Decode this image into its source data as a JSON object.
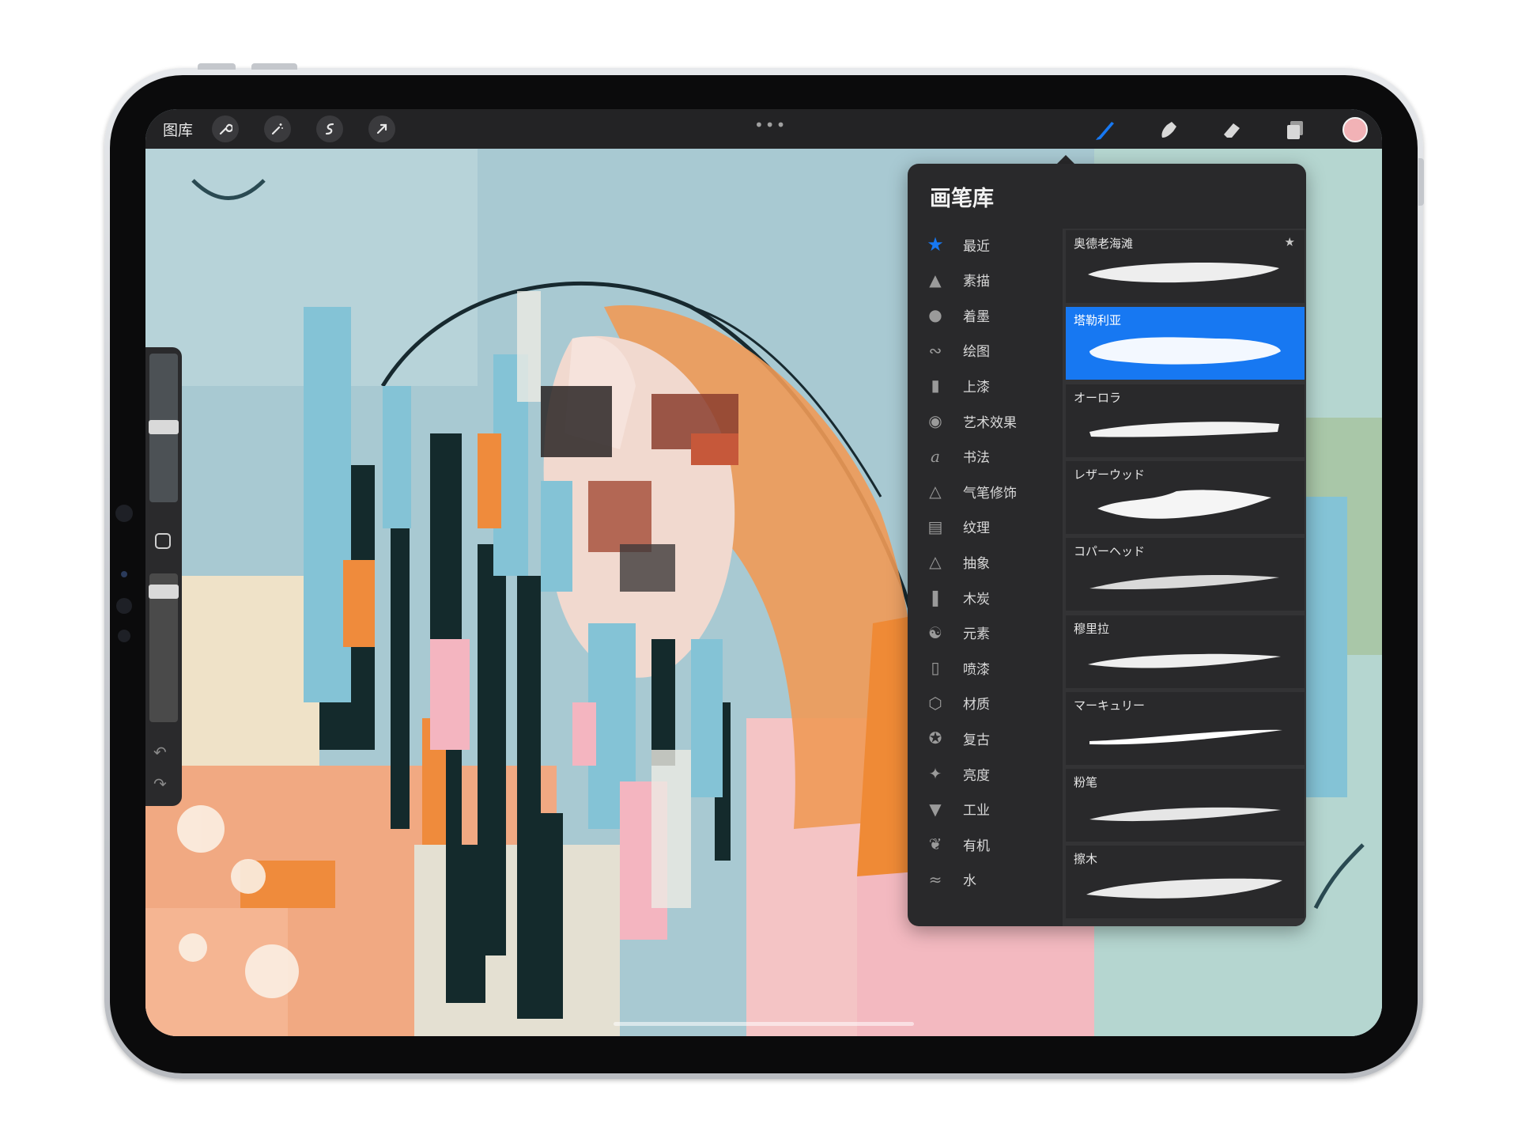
{
  "topbar": {
    "gallery_label": "图库",
    "more_indicator": "•••",
    "current_color": "#f2b2b6",
    "accent_color": "#1778f2",
    "tools_left": [
      "wrench-icon",
      "magic-wand-icon",
      "selection-icon",
      "transform-arrow-icon"
    ],
    "tools_right": [
      "brush-icon",
      "smudge-icon",
      "eraser-icon",
      "layers-icon"
    ]
  },
  "brush_library": {
    "title": "画笔库",
    "categories": [
      {
        "label": "最近",
        "icon": "star-icon",
        "selected": true
      },
      {
        "label": "素描",
        "icon": "pencil-tip-icon"
      },
      {
        "label": "着墨",
        "icon": "ink-drop-icon"
      },
      {
        "label": "绘图",
        "icon": "squiggle-icon"
      },
      {
        "label": "上漆",
        "icon": "paint-roller-icon"
      },
      {
        "label": "艺术效果",
        "icon": "palette-icon"
      },
      {
        "label": "书法",
        "icon": "calligraphy-icon"
      },
      {
        "label": "气笔修饰",
        "icon": "airbrush-icon"
      },
      {
        "label": "纹理",
        "icon": "texture-icon"
      },
      {
        "label": "抽象",
        "icon": "triangle-icon"
      },
      {
        "label": "木炭",
        "icon": "charcoal-icon"
      },
      {
        "label": "元素",
        "icon": "yin-yang-icon"
      },
      {
        "label": "喷漆",
        "icon": "spray-can-icon"
      },
      {
        "label": "材质",
        "icon": "cube-icon"
      },
      {
        "label": "复古",
        "icon": "badge-star-icon"
      },
      {
        "label": "亮度",
        "icon": "sparkle-icon"
      },
      {
        "label": "工业",
        "icon": "anvil-icon"
      },
      {
        "label": "有机",
        "icon": "leaf-icon"
      },
      {
        "label": "水",
        "icon": "waves-icon"
      }
    ],
    "brushes": [
      {
        "name": "奥德老海滩",
        "favorite": true
      },
      {
        "name": "塔勒利亚",
        "selected": true
      },
      {
        "name": "オーロラ"
      },
      {
        "name": "レザーウッド"
      },
      {
        "name": "コパーヘッド"
      },
      {
        "name": "穆里拉"
      },
      {
        "name": "マーキュリー"
      },
      {
        "name": "粉笔"
      },
      {
        "name": "擦木"
      }
    ]
  },
  "sidebar": {
    "undo_icon": "undo-icon",
    "redo_icon": "redo-icon"
  }
}
